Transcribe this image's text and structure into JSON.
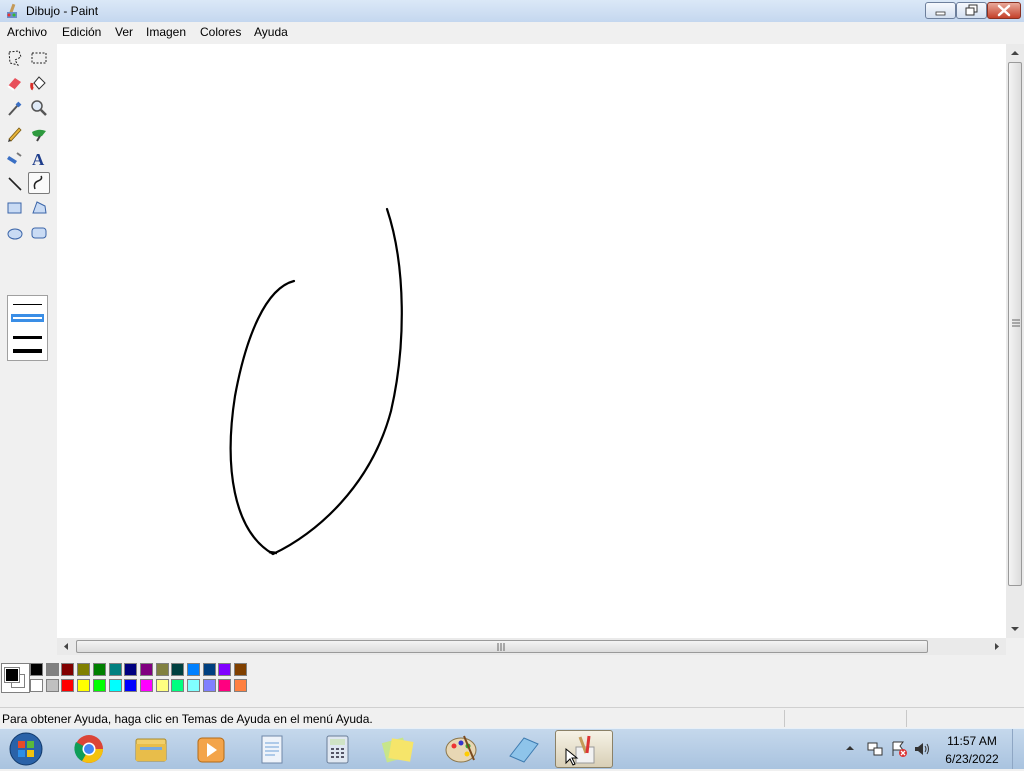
{
  "window": {
    "title": "Dibujo - Paint"
  },
  "menu": [
    "Archivo",
    "Edición",
    "Ver",
    "Imagen",
    "Colores",
    "Ayuda"
  ],
  "tools": [
    {
      "name": "free-form-select-icon",
      "selected": false
    },
    {
      "name": "rect-select-icon",
      "selected": false
    },
    {
      "name": "eraser-icon",
      "selected": false
    },
    {
      "name": "fill-bucket-icon",
      "selected": false
    },
    {
      "name": "color-picker-icon",
      "selected": false
    },
    {
      "name": "magnifier-icon",
      "selected": false
    },
    {
      "name": "pencil-icon",
      "selected": false
    },
    {
      "name": "brush-icon",
      "selected": false
    },
    {
      "name": "airbrush-icon",
      "selected": false
    },
    {
      "name": "text-tool-icon",
      "selected": false
    },
    {
      "name": "line-icon",
      "selected": false
    },
    {
      "name": "curve-icon",
      "selected": true
    },
    {
      "name": "rectangle-icon",
      "selected": false
    },
    {
      "name": "polygon-icon",
      "selected": false
    },
    {
      "name": "ellipse-icon",
      "selected": false
    },
    {
      "name": "rounded-rect-icon",
      "selected": false
    }
  ],
  "text_tool_glyph": "A",
  "palette": {
    "foreground": "#000000",
    "background": "#ffffff",
    "top_row": [
      "#000000",
      "#808080",
      "#800000",
      "#808000",
      "#008000",
      "#008080",
      "#000080",
      "#800080",
      "#808040",
      "#004040",
      "#0080ff",
      "#004080",
      "#8000ff",
      "#804000"
    ],
    "bottom_row": [
      "#ffffff",
      "#c0c0c0",
      "#ff0000",
      "#ffff00",
      "#00ff00",
      "#00ffff",
      "#0000ff",
      "#ff00ff",
      "#ffff80",
      "#00ff80",
      "#80ffff",
      "#8080ff",
      "#ff0080",
      "#ff8040"
    ]
  },
  "status": {
    "text": "Para obtener Ayuda, haga clic en Temas de Ayuda en el menú Ayuda."
  },
  "taskbar": {
    "apps": [
      "start-orb-icon",
      "chrome-icon",
      "explorer-icon",
      "media-player-icon",
      "document-icon",
      "calculator-icon",
      "sticky-notes-icon",
      "paint-palette-icon",
      "notepad-icon",
      "paint-icon"
    ],
    "active_app": "paint-icon",
    "time": "11:57 AM",
    "date": "6/23/2022"
  }
}
